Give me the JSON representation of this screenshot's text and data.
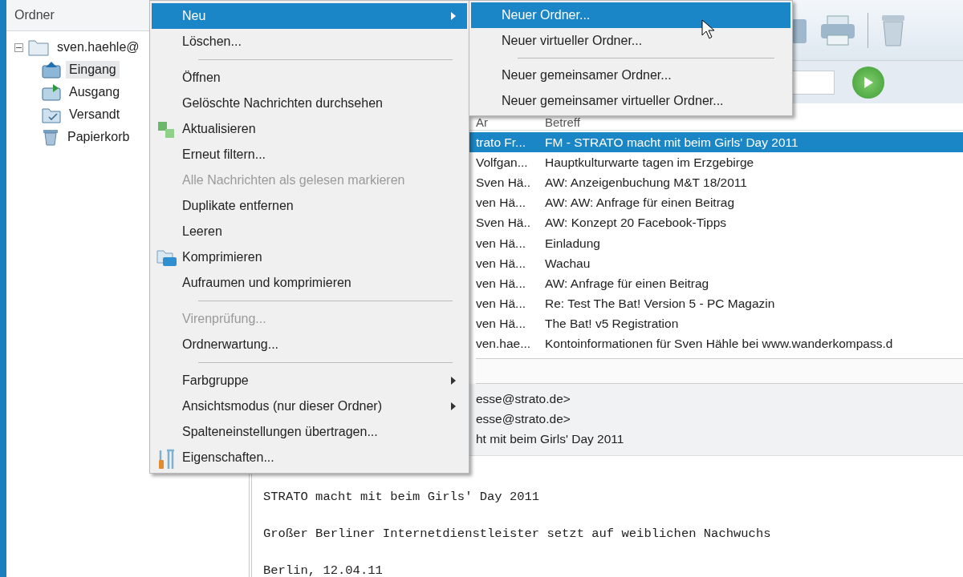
{
  "folder_panel": {
    "title": "Ordner",
    "tree": [
      {
        "label": "sven.haehle@",
        "expanded": true,
        "children": [
          {
            "label": "Eingang",
            "kind": "inbox",
            "selected": true
          },
          {
            "label": "Ausgang",
            "kind": "outbox",
            "selected": false
          },
          {
            "label": "Versandt",
            "kind": "sent",
            "selected": false
          },
          {
            "label": "Papierkorb",
            "kind": "trash",
            "selected": false
          }
        ]
      }
    ]
  },
  "message_list": {
    "columns": [
      "Ar",
      "Betreff"
    ],
    "rows": [
      {
        "from": "trato Fr...",
        "subject": "FM - STRATO macht mit beim Girls' Day 2011",
        "selected": true
      },
      {
        "from": "Volfgan...",
        "subject": "Hauptkulturwarte tagen im Erzgebirge",
        "selected": false
      },
      {
        "from": "Sven Hä..",
        "subject": "AW: Anzeigenbuchung M&T 18/2011",
        "selected": false
      },
      {
        "from": "ven Hä...",
        "subject": "AW: AW: Anfrage für einen Beitrag",
        "selected": false
      },
      {
        "from": "Sven Hä..",
        "subject": "AW: Konzept 20 Facebook-Tipps",
        "selected": false
      },
      {
        "from": "ven Hä...",
        "subject": "Einladung",
        "selected": false
      },
      {
        "from": "ven Hä...",
        "subject": "Wachau",
        "selected": false
      },
      {
        "from": "ven Hä...",
        "subject": "AW: Anfrage für einen Beitrag",
        "selected": false
      },
      {
        "from": "ven Hä...",
        "subject": "Re: Test The Bat! Version 5 - PC Magazin",
        "selected": false
      },
      {
        "from": "ven Hä...",
        "subject": "The Bat! v5 Registration",
        "selected": false
      },
      {
        "from": "ven.hae...",
        "subject": "Kontoinformationen für Sven Hähle bei www.wanderkompass.d",
        "selected": false
      }
    ]
  },
  "preview_header": [
    "esse@strato.de>",
    "esse@strato.de>",
    "ht mit beim Girls' Day 2011"
  ],
  "preview_body": [
    "STRATO macht mit beim Girls' Day 2011",
    "Großer Berliner Internetdienstleister setzt auf weiblichen Nachwuchs",
    "Berlin, 12.04.11"
  ],
  "context_menu": [
    {
      "kind": "item",
      "label": "Neu",
      "selected": true,
      "disabled": false,
      "submenu": true
    },
    {
      "kind": "item",
      "label": "Löschen...",
      "selected": false,
      "disabled": false,
      "submenu": false
    },
    {
      "kind": "separator"
    },
    {
      "kind": "item",
      "label": "Öffnen",
      "selected": false,
      "disabled": false,
      "submenu": false
    },
    {
      "kind": "item",
      "label": "Gelöschte Nachrichten durchsehen",
      "selected": false,
      "disabled": false,
      "submenu": false
    },
    {
      "kind": "sync",
      "label": "Aktualisieren",
      "selected": false,
      "disabled": false,
      "submenu": false
    },
    {
      "kind": "item",
      "label": "Erneut filtern...",
      "selected": false,
      "disabled": false,
      "submenu": false
    },
    {
      "kind": "item",
      "label": "Alle Nachrichten als gelesen markieren",
      "selected": false,
      "disabled": true,
      "submenu": false
    },
    {
      "kind": "item",
      "label": "Duplikate entfernen",
      "selected": false,
      "disabled": false,
      "submenu": false
    },
    {
      "kind": "item",
      "label": "Leeren",
      "selected": false,
      "disabled": false,
      "submenu": false
    },
    {
      "kind": "compress",
      "label": "Komprimieren",
      "selected": false,
      "disabled": false,
      "submenu": false
    },
    {
      "kind": "item",
      "label": "Aufraumen und komprimieren",
      "selected": false,
      "disabled": false,
      "submenu": false
    },
    {
      "kind": "separator"
    },
    {
      "kind": "item",
      "label": "Virenprüfung...",
      "selected": false,
      "disabled": true,
      "submenu": false
    },
    {
      "kind": "item",
      "label": "Ordnerwartung...",
      "selected": false,
      "disabled": false,
      "submenu": false
    },
    {
      "kind": "separator"
    },
    {
      "kind": "item",
      "label": "Farbgruppe",
      "selected": false,
      "disabled": false,
      "submenu": true
    },
    {
      "kind": "item",
      "label": "Ansichtsmodus (nur dieser Ordner)",
      "selected": false,
      "disabled": false,
      "submenu": true
    },
    {
      "kind": "item",
      "label": "Spalteneinstellungen übertragen...",
      "selected": false,
      "disabled": false,
      "submenu": false
    },
    {
      "kind": "tools",
      "label": "Eigenschaften...",
      "selected": false,
      "disabled": false,
      "submenu": false
    }
  ],
  "submenu": [
    {
      "kind": "item",
      "label": "Neuer Ordner...",
      "selected": true
    },
    {
      "kind": "item",
      "label": "Neuer virtueller Ordner...",
      "selected": false
    },
    {
      "kind": "separator"
    },
    {
      "kind": "item",
      "label": "Neuer gemeinsamer Ordner...",
      "selected": false
    },
    {
      "kind": "item",
      "label": "Neuer gemeinsamer virtueller Ordner...",
      "selected": false
    }
  ]
}
